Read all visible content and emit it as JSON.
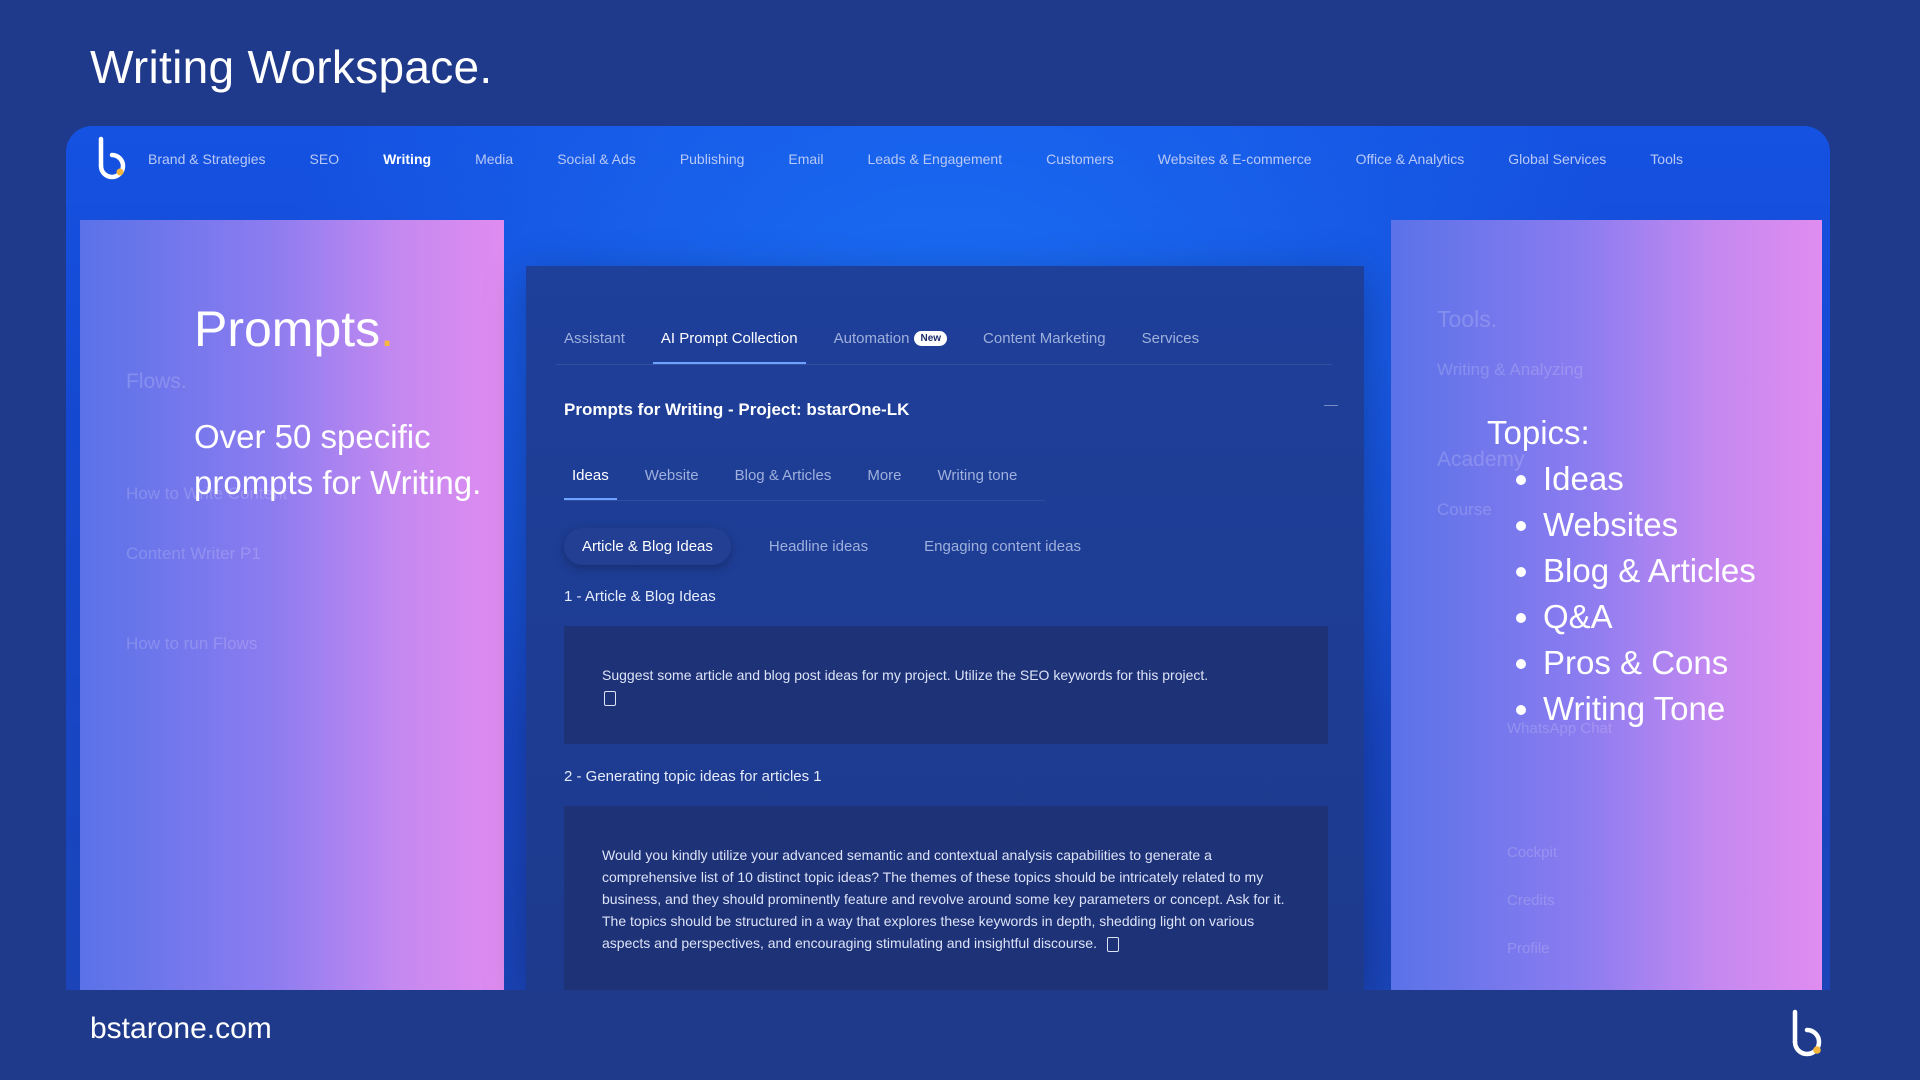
{
  "slide": {
    "title": "Writing Workspace.",
    "footer_url": "bstarone.com"
  },
  "nav": {
    "items": [
      "Brand & Strategies",
      "SEO",
      "Writing",
      "Media",
      "Social & Ads",
      "Publishing",
      "Email",
      "Leads & Engagement",
      "Customers",
      "Websites & E-commerce",
      "Office & Analytics",
      "Global Services",
      "Tools"
    ],
    "active": "Writing"
  },
  "left_overlay": {
    "heading": "Prompts",
    "heading_dot": ".",
    "subtitle": "Over 50 specific prompts for Writing."
  },
  "left_panel_faded": {
    "flows": "Flows.",
    "item1": "How to Write Content",
    "item2": "Content Writer P1",
    "item3": "How to run Flows"
  },
  "right_overlay": {
    "heading": "Topics:",
    "topics": [
      "Ideas",
      "Websites",
      "Blog & Articles",
      "Q&A",
      "Pros & Cons",
      "Writing Tone"
    ]
  },
  "right_panel_faded": {
    "tools": "Tools.",
    "writing_analyzing": "Writing & Analyzing",
    "academy": "Academy",
    "course": "Course",
    "whatsapp": "WhatsApp Chat",
    "cockpit": "Cockpit",
    "credits": "Credits",
    "profile": "Profile"
  },
  "main": {
    "tabs": [
      {
        "label": "Assistant"
      },
      {
        "label": "AI Prompt Collection"
      },
      {
        "label": "Automation",
        "badge": "New"
      },
      {
        "label": "Content Marketing"
      },
      {
        "label": "Services"
      }
    ],
    "active_tab": "AI Prompt Collection",
    "project_title": "Prompts for Writing - Project: bstarOne-LK",
    "collapse_symbol": "—",
    "subtabs": [
      "Ideas",
      "Website",
      "Blog & Articles",
      "More",
      "Writing tone"
    ],
    "active_subtab": "Ideas",
    "pills": [
      "Article & Blog Ideas",
      "Headline ideas",
      "Engaging content ideas"
    ],
    "active_pill": "Article & Blog Ideas",
    "prompts": [
      {
        "label": "1 - Article & Blog Ideas",
        "text": "Suggest some article and blog post ideas for my project. Utilize the SEO keywords for this project."
      },
      {
        "label": "2 - Generating topic ideas for articles 1",
        "text": "Would you kindly utilize your advanced semantic and contextual analysis capabilities to generate a comprehensive list of 10 distinct topic ideas? The themes of these topics should be intricately related to my business, and they should prominently feature and revolve around some key parameters or concept. Ask for it. The topics should be structured in a way that explores these keywords in depth, shedding light on various aspects and perspectives, and encouraging stimulating and insightful discourse."
      }
    ]
  },
  "colors": {
    "background": "#1f3a8a",
    "accent_dot": "#f6b73c",
    "tab_underline": "#6ea2ff"
  }
}
